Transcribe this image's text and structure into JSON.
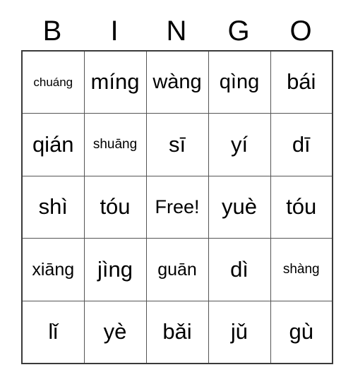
{
  "card": {
    "title": "BINGO",
    "header_letters": [
      "B",
      "I",
      "N",
      "G",
      "O"
    ],
    "free_space_label": "Free!",
    "grid_size": "5x5",
    "colors": {
      "background": "#ffffff",
      "text": "#000000",
      "outer_border": "#3a3a3a",
      "inner_border": "#555555"
    },
    "rows": [
      [
        {
          "text": "chuáng",
          "size": "xs"
        },
        {
          "text": "míng",
          "size": "xl"
        },
        {
          "text": "wàng",
          "size": "lg"
        },
        {
          "text": "qìng",
          "size": "lg"
        },
        {
          "text": "bái",
          "size": "xl"
        }
      ],
      [
        {
          "text": "qián",
          "size": "xl"
        },
        {
          "text": "shuāng",
          "size": "sm"
        },
        {
          "text": "sī",
          "size": "xl"
        },
        {
          "text": "yí",
          "size": "xl"
        },
        {
          "text": "dī",
          "size": "xl"
        }
      ],
      [
        {
          "text": "shì",
          "size": "xl"
        },
        {
          "text": "tóu",
          "size": "xl"
        },
        {
          "text": "Free!",
          "size": "md"
        },
        {
          "text": "yuè",
          "size": "xl"
        },
        {
          "text": "tóu",
          "size": "xl"
        }
      ],
      [
        {
          "text": "xiāng",
          "size": "md"
        },
        {
          "text": "jìng",
          "size": "xl"
        },
        {
          "text": "guān",
          "size": "md"
        },
        {
          "text": "dì",
          "size": "xl"
        },
        {
          "text": "shàng",
          "size": "sm"
        }
      ],
      [
        {
          "text": "lǐ",
          "size": "xl"
        },
        {
          "text": "yè",
          "size": "xl"
        },
        {
          "text": "bǎi",
          "size": "xl"
        },
        {
          "text": "jǔ",
          "size": "xl"
        },
        {
          "text": "gù",
          "size": "xl"
        }
      ]
    ]
  }
}
